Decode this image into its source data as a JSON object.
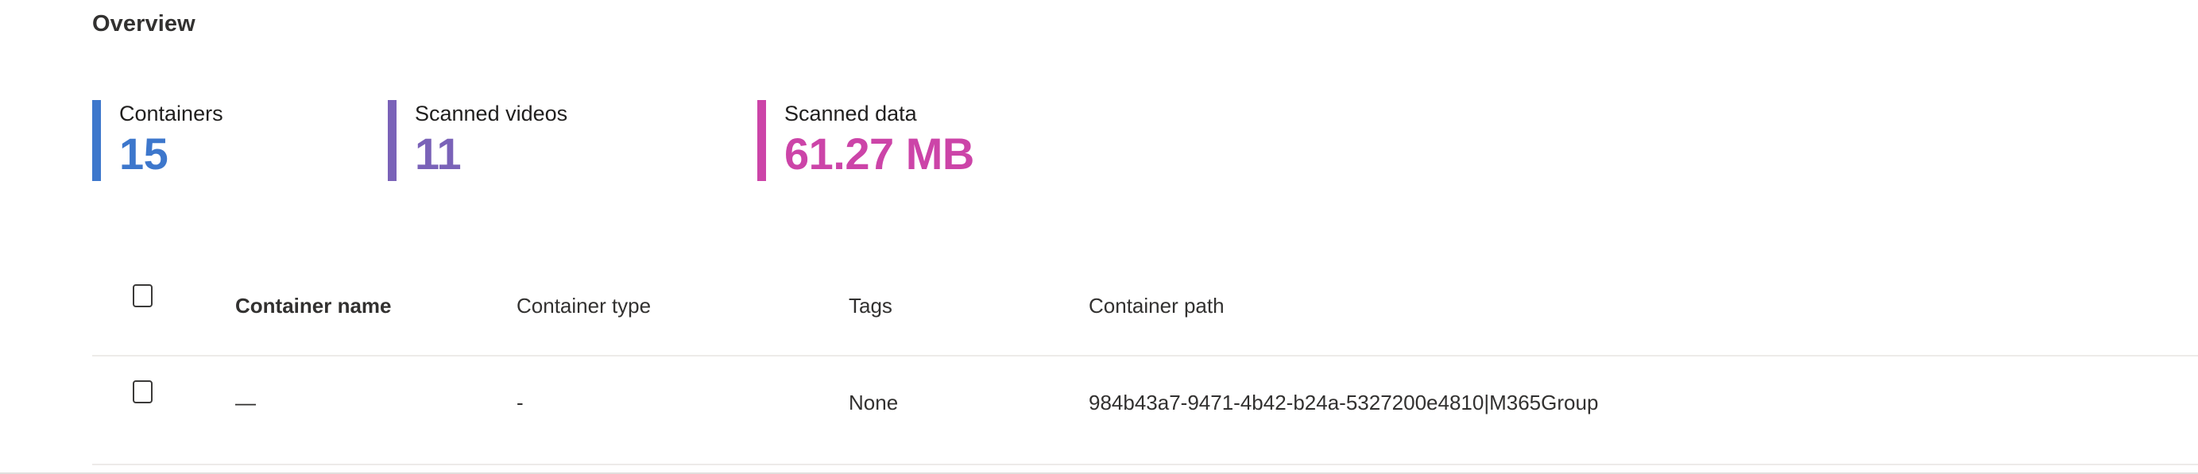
{
  "section": {
    "title": "Overview"
  },
  "metrics": [
    {
      "id": "containers",
      "label": "Containers",
      "value": "15",
      "color": "#3d77cc"
    },
    {
      "id": "scanned-videos",
      "label": "Scanned videos",
      "value": "11",
      "color": "#7a62b8"
    },
    {
      "id": "scanned-data",
      "label": "Scanned data",
      "value": "61.27 MB",
      "color": "#cc44a8"
    }
  ],
  "table": {
    "select_all_checkbox": "select-all",
    "columns": [
      {
        "key": "name",
        "label": "Container name",
        "bold": true
      },
      {
        "key": "type",
        "label": "Container type",
        "bold": false
      },
      {
        "key": "tags",
        "label": "Tags",
        "bold": false
      },
      {
        "key": "path",
        "label": "Container path",
        "bold": false
      }
    ],
    "rows": [
      {
        "selected": false,
        "name": "—",
        "type": "-",
        "tags": "None",
        "path": "984b43a7-9471-4b42-b24a-5327200e4810|M365Group"
      }
    ]
  }
}
